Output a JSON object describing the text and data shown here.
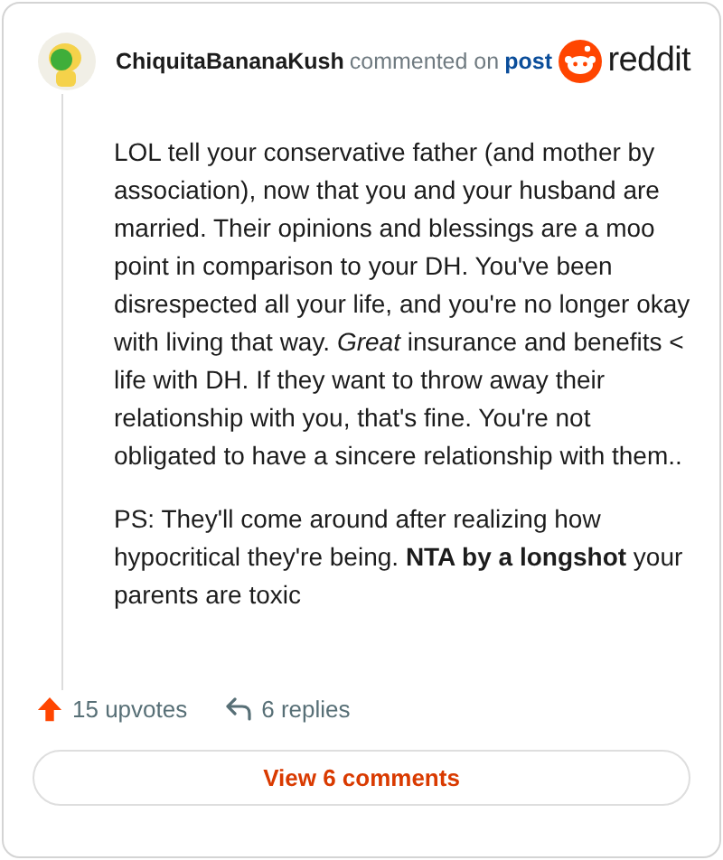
{
  "header": {
    "username": "ChiquitaBananaKush",
    "action": "commented on",
    "link": "post",
    "brand": "reddit"
  },
  "paragraphs": [
    "LOL tell your conservative father (and mother by association), now that you and your husband are married. Their opinions and blessings are a moo point in comparison to your DH. You've been disrespected all your life, and you're no longer okay with living that way. *Great* insurance and benefits < life with DH. If they want to throw away their relationship with you, that's fine. You're not obligated to have a sincere relationship with them..",
    "PS: They'll come around after realizing how hypocritical they're being. **NTA by a longshot** your parents are toxic"
  ],
  "footer": {
    "upvotes": "15 upvotes",
    "replies": "6 replies",
    "button": "View 6 comments"
  }
}
